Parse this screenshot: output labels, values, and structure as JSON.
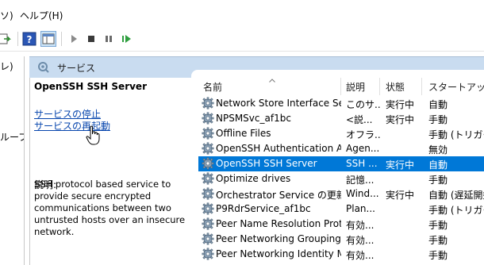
{
  "menu": {
    "left_fragment": "ソ)",
    "help": "ヘルプ(H)"
  },
  "left_tree": {
    "item1": "レ)",
    "item2": "ループ"
  },
  "panel": {
    "title": "サービス"
  },
  "detail": {
    "service_name": "OpenSSH SSH Server",
    "stop_link": "サービスの停止",
    "restart_link": "サービスの再起動",
    "description_label": "説明:",
    "description": "SSH protocol based service to provide secure encrypted communications between two untrusted hosts over an insecure network."
  },
  "columns": {
    "name": "名前",
    "description": "説明",
    "status": "状態",
    "startup": "スタートアップの"
  },
  "services": [
    {
      "name": "Network Store Interface Ser...",
      "desc": "このサ...",
      "status": "実行中",
      "startup": "自動"
    },
    {
      "name": "NPSMSvc_af1bc",
      "desc": "<説...",
      "status": "実行中",
      "startup": "手動"
    },
    {
      "name": "Offline Files",
      "desc": "オフラ...",
      "status": "",
      "startup": "手動 (トリガー開"
    },
    {
      "name": "OpenSSH Authentication A...",
      "desc": "Agen...",
      "status": "",
      "startup": "無効"
    },
    {
      "name": "OpenSSH SSH Server",
      "desc": "SSH ...",
      "status": "実行中",
      "startup": "自動"
    },
    {
      "name": "Optimize drives",
      "desc": "記憶...",
      "status": "",
      "startup": "手動"
    },
    {
      "name": "Orchestrator Service の更新",
      "desc": "Wind...",
      "status": "実行中",
      "startup": "自動 (遅延開始"
    },
    {
      "name": "P9RdrService_af1bc",
      "desc": "Plan...",
      "status": "",
      "startup": "手動 (トリガー開"
    },
    {
      "name": "Peer Name Resolution Prot...",
      "desc": "有効...",
      "status": "",
      "startup": "手動"
    },
    {
      "name": "Peer Networking Grouping",
      "desc": "有効...",
      "status": "",
      "startup": "手動"
    },
    {
      "name": "Peer Networking Identity M...",
      "desc": "有効...",
      "status": "",
      "startup": "手動"
    }
  ],
  "selected_index": 4,
  "colors": {
    "selection": "#0078d7",
    "panel_header": "#c9dcf0",
    "link": "#0645ad"
  }
}
